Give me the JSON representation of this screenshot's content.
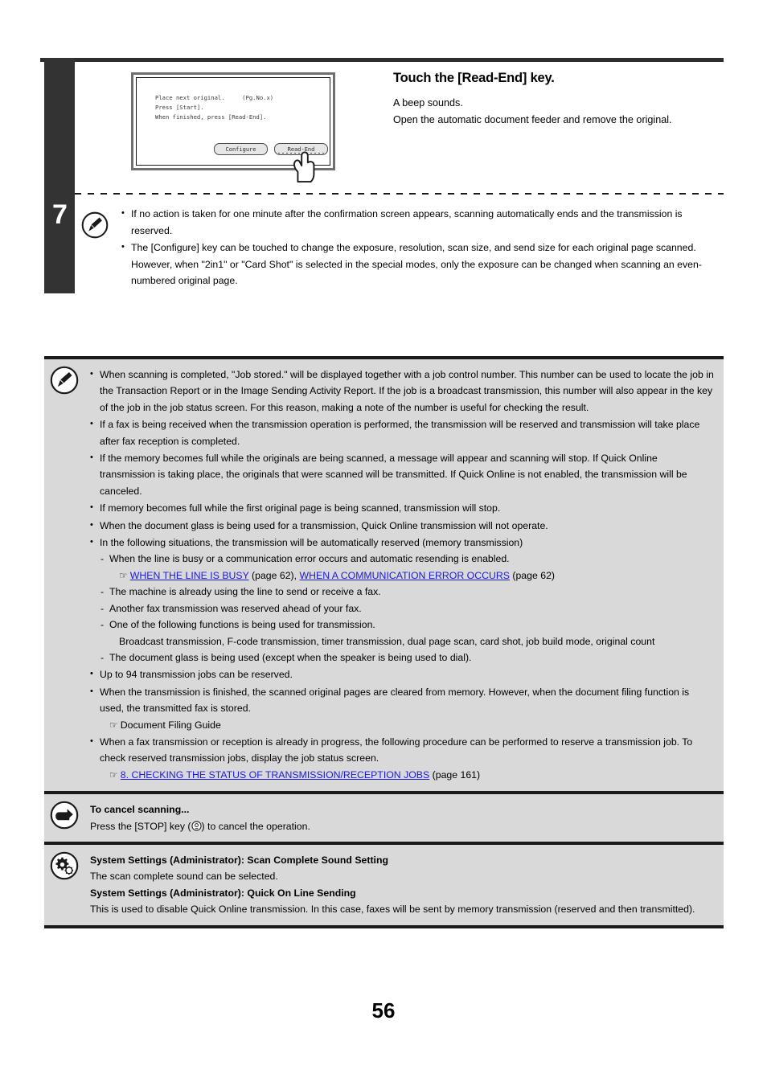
{
  "page": {
    "number": "56",
    "step_number": "7"
  },
  "step": {
    "heading": "Touch the [Read-End] key.",
    "sub_line_1": "A beep sounds.",
    "sub_line_2": "Open the automatic document feeder and remove the original.",
    "lcd": {
      "line1": "Place next original.     (Pg.No.x)",
      "line2": "Press [Start].",
      "line3": "When finished, press [Read-End].",
      "button_configure": "Configure",
      "button_read_end": "Read-End"
    },
    "notes": [
      "If no action is taken for one minute after the confirmation screen appears, scanning automatically ends and the transmission is reserved.",
      "The [Configure] key can be touched to change the exposure, resolution, scan size, and send size for each original page scanned. However, when \"2in1\" or \"Card Shot\" is selected in the special modes, only the exposure can be changed when scanning an even-numbered original page."
    ]
  },
  "info_box": {
    "notes": [
      "When scanning is completed, \"Job stored.\" will be displayed together with a job control number. This number can be used to locate the job in the Transaction Report or in the Image Sending Activity Report. If the job is a broadcast transmission, this number will also appear in the key of the job in the job status screen. For this reason, making a note of the number is useful for checking the result.",
      "If a fax is being received when the transmission operation is performed, the transmission will be reserved and transmission will take place after fax reception is completed.",
      "If the memory becomes full while the originals are being scanned, a message will appear and scanning will stop. If Quick Online transmission is taking place, the originals that were scanned will be transmitted. If Quick Online is not enabled, the transmission will be canceled.",
      "If memory becomes full while the first original page is being scanned, transmission will stop.",
      "When the document glass is being used for a transmission, Quick Online transmission will not operate."
    ],
    "situations_intro": "In the following situations, the transmission will be automatically reserved (memory transmission)",
    "situations": [
      "When the line is busy or a communication error occurs and automatic resending is enabled.",
      "The machine is already using the line to send or receive a fax.",
      "Another fax transmission was reserved ahead of your fax.",
      "One of the following functions is being used for transmission.",
      "The document glass is being used (except when the speaker is being used to dial)."
    ],
    "functions_list": "Broadcast transmission, F-code transmission, timer transmission, dual page scan, card shot, job build mode, original count",
    "link_row": {
      "link1_text": "WHEN THE LINE IS BUSY",
      "link1_page": "(page 62),",
      "link2_text": "WHEN A COMMUNICATION ERROR OCCURS",
      "link2_page": "(page 62)"
    },
    "reserve_limit": "Up to 94 transmission jobs can be reserved.",
    "finished_note": "When the transmission is finished, the scanned original pages are cleared from memory. However, when the document filing function is used, the transmitted fax is stored.",
    "doc_filing_guide": "Document Filing Guide",
    "in_progress_note": "When a fax transmission or reception is already in progress, the following procedure can be performed to reserve a transmission job. To check reserved transmission jobs, display the job status screen.",
    "status_link_text": "8. CHECKING THE STATUS OF TRANSMISSION/RECEPTION JOBS",
    "status_link_page": "(page 161)"
  },
  "cancel_box": {
    "title": "To cancel scanning...",
    "body_prefix": "Press the [STOP] key (",
    "body_suffix": ") to cancel the operation."
  },
  "settings_box": {
    "title1": "System Settings (Administrator): Scan Complete Sound Setting",
    "body1": "The scan complete sound can be selected.",
    "title2": "System Settings (Administrator): Quick On Line Sending",
    "body2": "This is used to disable Quick Online transmission. In this case, faxes will be sent by memory transmission (reserved and then transmitted)."
  },
  "colors": {
    "link": "#1b1bdc",
    "grey_panel": "#d9d9d9",
    "sidebar": "#333333",
    "rule": "#1a1a1a"
  }
}
